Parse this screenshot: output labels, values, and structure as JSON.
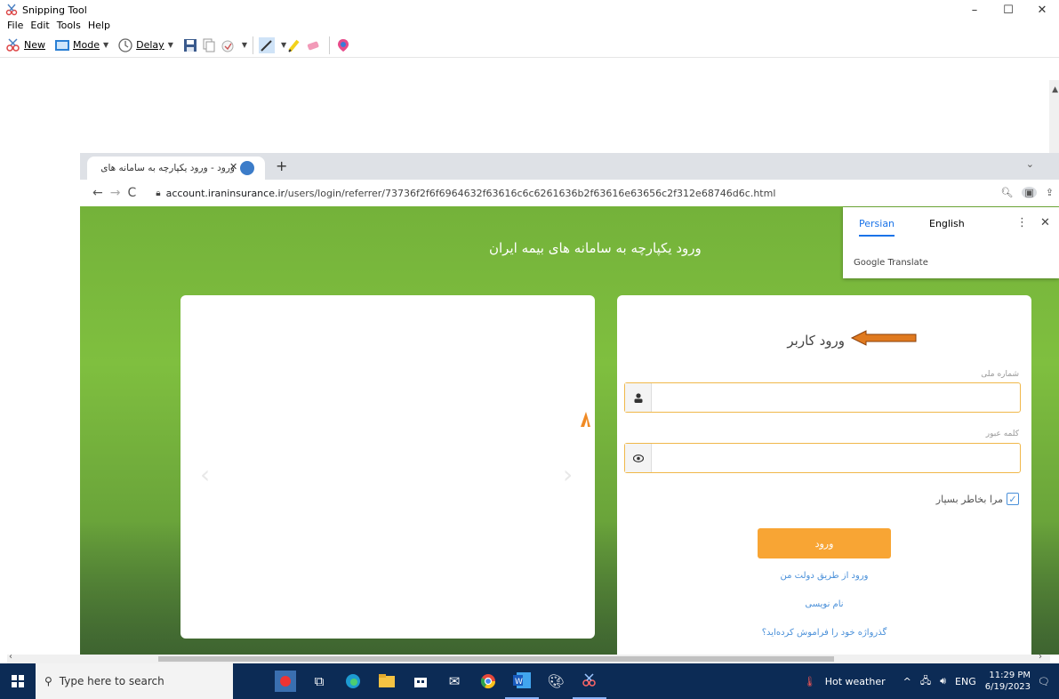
{
  "snipping_tool": {
    "title": "Snipping Tool",
    "menu": [
      "File",
      "Edit",
      "Tools",
      "Help"
    ],
    "toolbar": {
      "new_label": "New",
      "mode_label": "Mode",
      "delay_label": "Delay"
    },
    "window_buttons": {
      "minimize": "–",
      "maximize": "☐",
      "close": "✕"
    }
  },
  "browser": {
    "tab_title": "ورود - ورود یکپارچه به سامانه های",
    "tab_close": "✕",
    "new_tab": "+",
    "url_host": "account.iraninsurance.ir",
    "url_path": "/users/login/referrer/73736f2f6f6964632f63616c6c6261636b2f63616e63656c2f312e68746d6c.html"
  },
  "translate_popup": {
    "tab_persian": "Persian",
    "tab_english": "English",
    "brand": "Google Translate"
  },
  "page": {
    "heading": "ورود یکپارچه به سامانه های بیمه ایران",
    "login_title": "ورود کاربر",
    "national_id_label": "شماره ملی",
    "password_label": "کلمه عبور",
    "remember_me": "مرا بخاطر بسپار",
    "login_button": "ورود",
    "gov_login_link": "ورود از طریق دولت من",
    "register_link": "نام نویسی",
    "forgot_link": "گذرواژه خود را فراموش کرده‌اید؟"
  },
  "taskbar": {
    "search_placeholder": "Type here to search",
    "weather": "Hot weather",
    "language": "ENG",
    "time": "11:29 PM",
    "date": "6/19/2023"
  },
  "colors": {
    "page_green": "#7fbf3f",
    "login_button": "#f8a534",
    "field_border": "#f0b84a",
    "link_blue": "#4a90d9",
    "taskbar": "#0c2b55"
  }
}
